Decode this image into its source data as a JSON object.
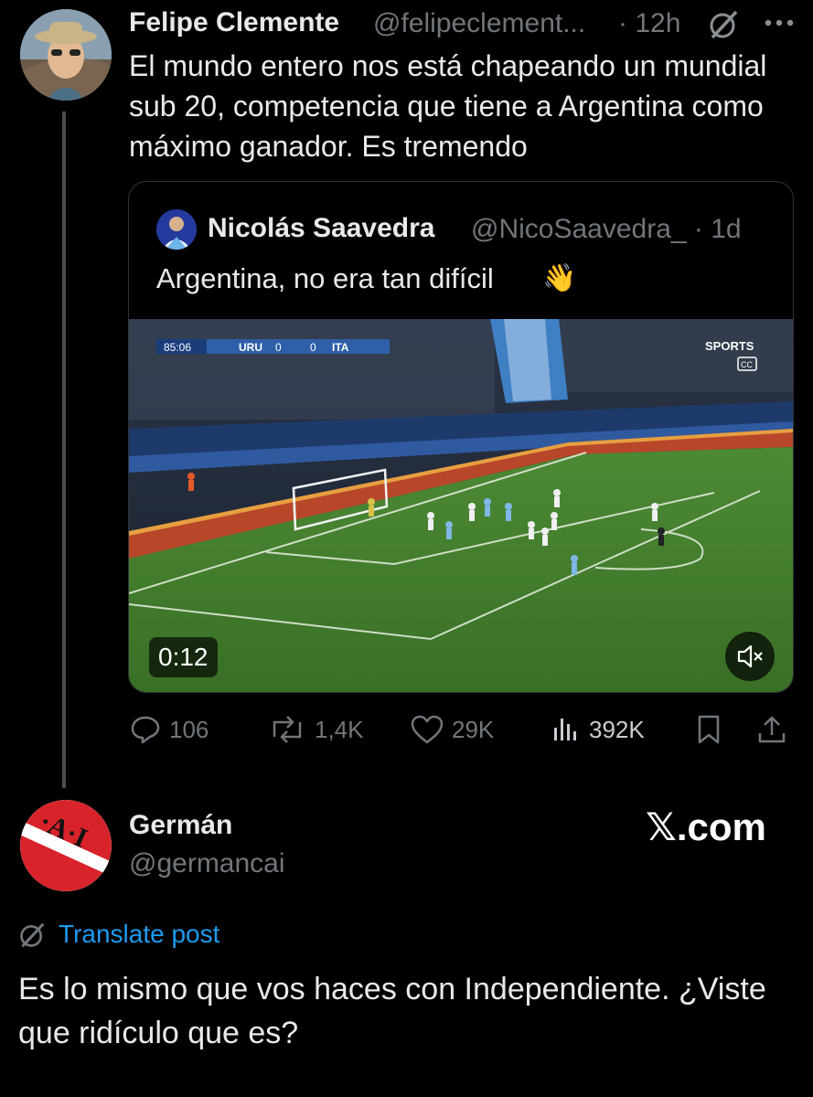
{
  "parent_post": {
    "name": "Felipe Clemente",
    "handle": "@felipeclement...",
    "time": "· 12h",
    "text": "El mundo entero nos está chapeando un mundial sub 20, competencia que tiene a Argentina como máximo ganador. Es tremendo"
  },
  "quoted_post": {
    "name": "Nicolás Saavedra",
    "handle": "@NicoSaavedra_ · 1d",
    "text": "Argentina, no era tan difícil",
    "emoji": "👋",
    "video": {
      "duration": "0:12",
      "scoreboard_time": "85:06",
      "team_home": "URU",
      "score_home": "0",
      "score_away": "0",
      "team_away": "ITA",
      "broadcaster": "SPORTS",
      "cc": "CC"
    }
  },
  "actions": {
    "replies": "106",
    "reposts": "1,4K",
    "likes": "29K",
    "views": "392K"
  },
  "reply_post": {
    "name": "Germán",
    "handle": "@germancai",
    "badge": "𝕏.com",
    "translate": "Translate post",
    "text": "Es lo mismo que vos haces con Independiente. ¿Viste que ridículo que es?",
    "avatar_letters": "·A·I"
  },
  "colors": {
    "background": "#000000",
    "text": "#e7e9ea",
    "muted": "#71767b",
    "link": "#1d9bf0",
    "pitch": "#3f7a2a",
    "independiente_red": "#d8232a"
  }
}
